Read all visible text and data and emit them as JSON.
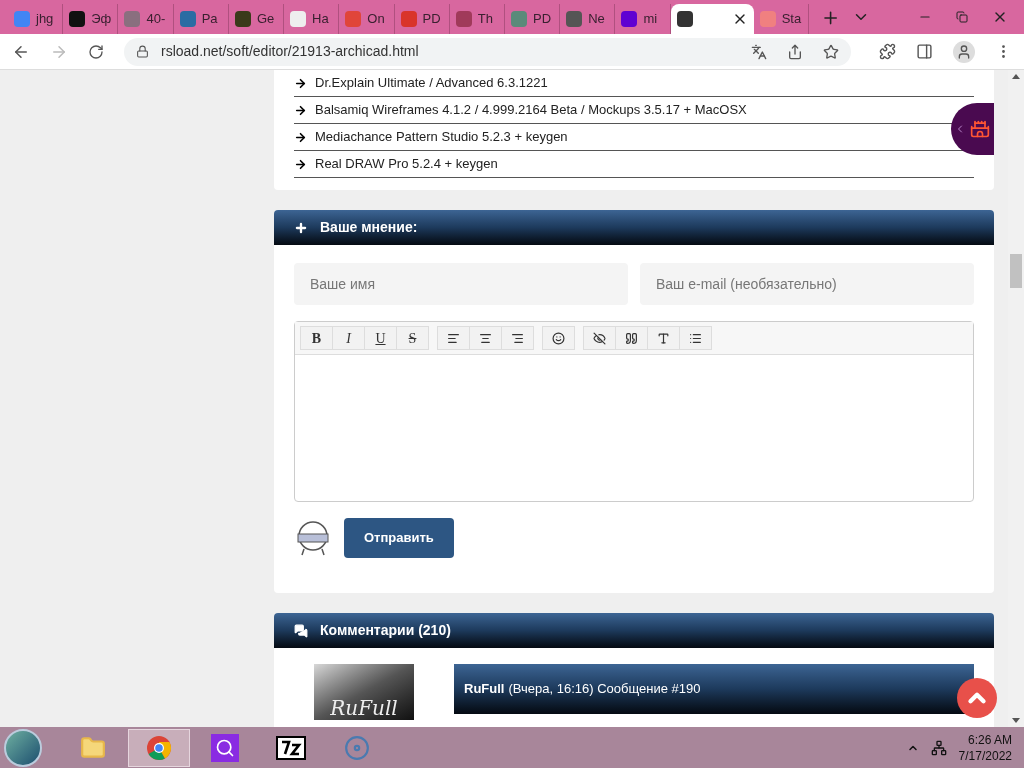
{
  "browser": {
    "tabs": [
      {
        "label": "jhg",
        "selected": false,
        "color": "#4285f4"
      },
      {
        "label": "Эф",
        "selected": false,
        "color": "#111111"
      },
      {
        "label": "40-",
        "selected": false,
        "color": "#8a6f7f"
      },
      {
        "label": "Pa",
        "selected": false,
        "color": "#2b6ca3"
      },
      {
        "label": "Ge",
        "selected": false,
        "color": "#3a3a1a"
      },
      {
        "label": "Ha",
        "selected": false,
        "color": "#eeeeee"
      },
      {
        "label": "On",
        "selected": false,
        "color": "#e0453a"
      },
      {
        "label": "PD",
        "selected": false,
        "color": "#d9342b"
      },
      {
        "label": "Th",
        "selected": false,
        "color": "#a03a5a"
      },
      {
        "label": "PD",
        "selected": false,
        "color": "#5a8a7a"
      },
      {
        "label": "Ne",
        "selected": false,
        "color": "#555555"
      },
      {
        "label": "mi",
        "selected": false,
        "color": "#6001d2"
      },
      {
        "selected": true,
        "color": "#333333"
      },
      {
        "label": "Sta",
        "selected": false,
        "color": "#f08080"
      }
    ],
    "url": "rsload.net/soft/editor/21913-archicad.html"
  },
  "related_list": [
    "Dr.Explain Ultimate / Advanced 6.3.1221",
    "Balsamiq Wireframes 4.1.2 / 4.999.2164 Beta / Mockups 3.5.17 + MacOSX",
    "Mediachance Pattern Studio 5.2.3 + keygen",
    "Real DRAW Pro 5.2.4 + keygen"
  ],
  "comment_form": {
    "title": "Ваше мнение:",
    "name_placeholder": "Ваше имя",
    "email_placeholder": "Ваш e-mail (необязательно)",
    "toolbar": [
      [
        {
          "kind": "bold",
          "label": "B"
        },
        {
          "kind": "italic",
          "label": "I"
        },
        {
          "kind": "underline",
          "label": "U"
        },
        {
          "kind": "strike",
          "label": "S"
        }
      ],
      [
        {
          "kind": "align-left"
        },
        {
          "kind": "align-center"
        },
        {
          "kind": "align-right"
        }
      ],
      [
        {
          "kind": "smiley"
        }
      ],
      [
        {
          "kind": "hide"
        },
        {
          "kind": "quote"
        },
        {
          "kind": "font-size"
        },
        {
          "kind": "list"
        }
      ]
    ],
    "submit": "Отправить"
  },
  "comments": {
    "title": "Комментарии (210)",
    "items": [
      {
        "avatar_text": "RuFull",
        "author": "RuFull",
        "meta": "(Вчера, 16:16) Сообщение #190"
      }
    ]
  },
  "taskbar": {
    "apps": [
      {
        "kind": "explorer",
        "selected": false
      },
      {
        "kind": "chrome",
        "selected": true
      },
      {
        "kind": "search",
        "selected": false
      },
      {
        "kind": "archiver",
        "selected": false
      },
      {
        "kind": "disc",
        "selected": false
      }
    ],
    "time": "6:26 AM",
    "date": "7/17/2022"
  }
}
